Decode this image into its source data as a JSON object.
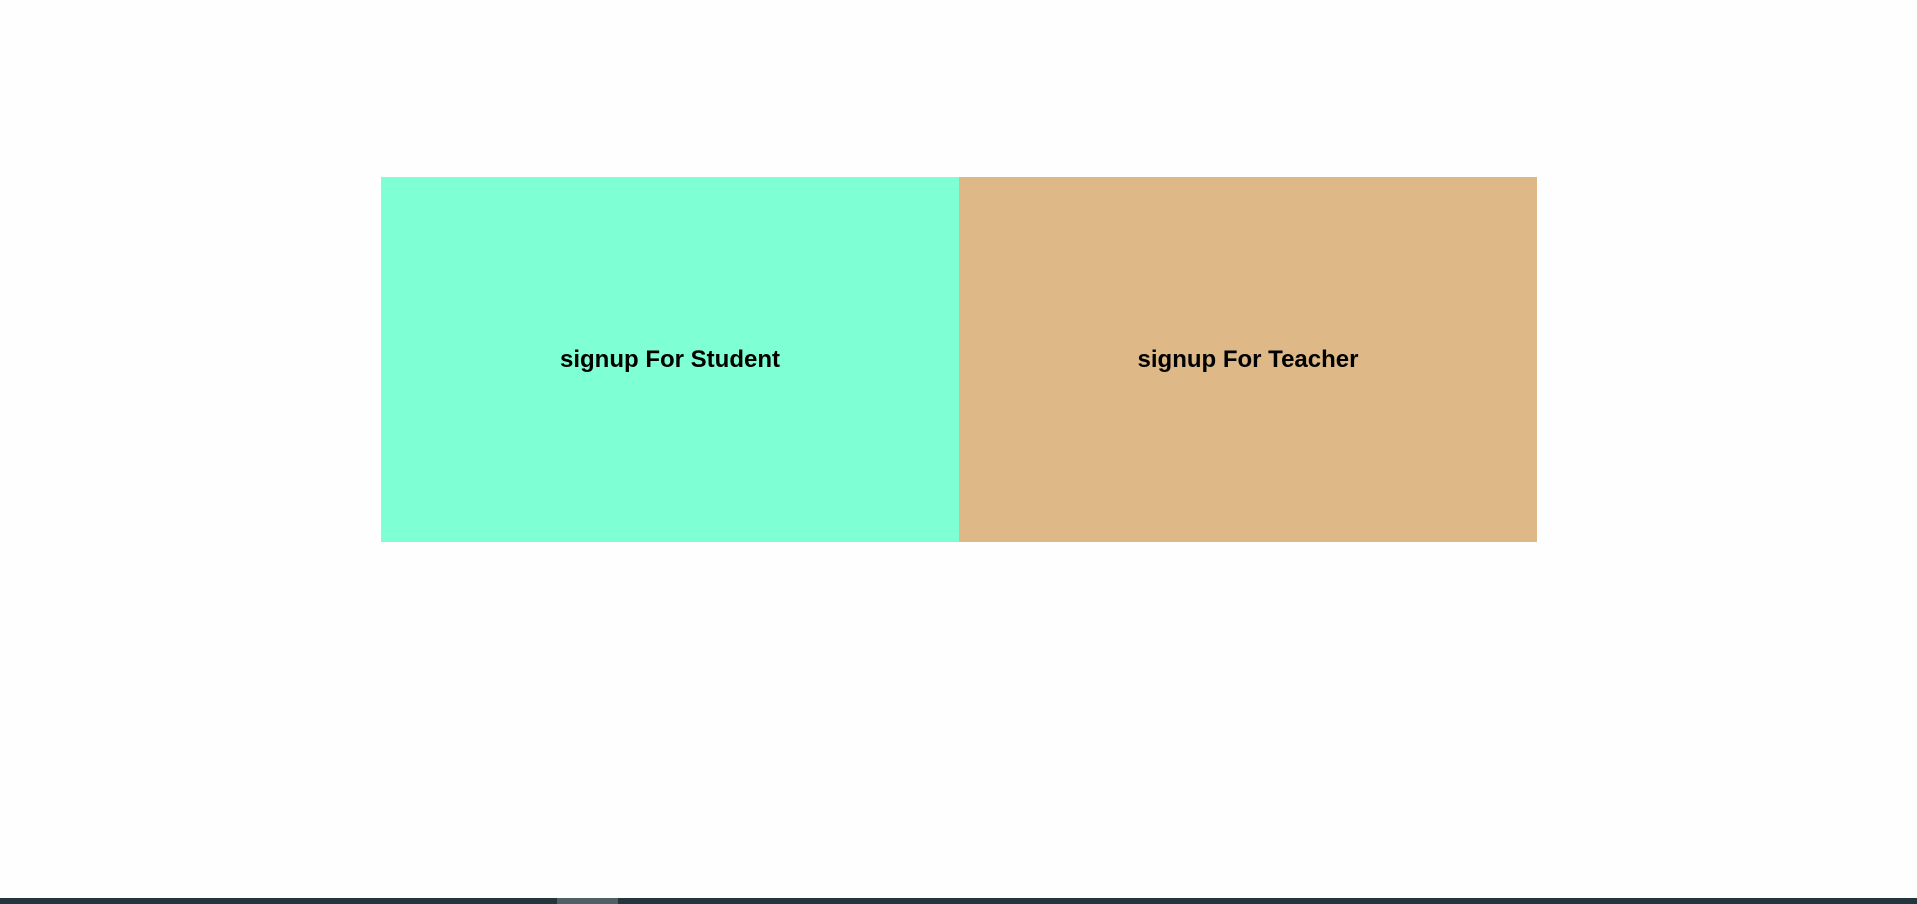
{
  "options": {
    "student": {
      "label": "signup For Student",
      "color": "#7fffd4"
    },
    "teacher": {
      "label": "signup For Teacher",
      "color": "#deb887"
    }
  },
  "scrollbar": {
    "position_fraction": 0.29
  }
}
